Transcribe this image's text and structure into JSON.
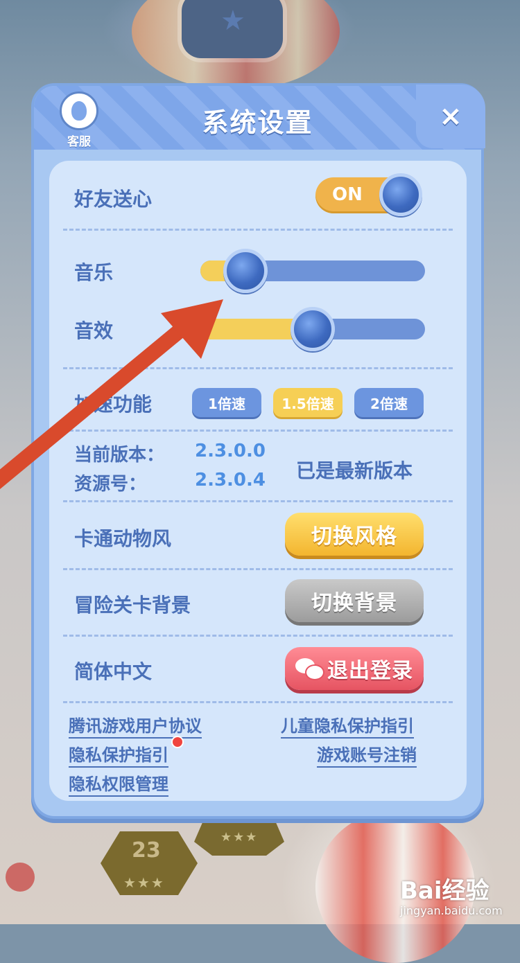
{
  "dialog": {
    "title": "系统设置",
    "service_label": "客服",
    "close_symbol": "×"
  },
  "friend_heart": {
    "label": "好友送心",
    "toggle_text": "ON",
    "enabled": true
  },
  "music": {
    "label": "音乐",
    "level": 0.2
  },
  "sound_effect": {
    "label": "音效",
    "level": 0.5
  },
  "speed": {
    "label": "加速功能",
    "options": [
      "1倍速",
      "1.5倍速",
      "2倍速"
    ],
    "selected": "1.5倍速"
  },
  "version": {
    "current_label": "当前版本：",
    "current_value": "2.3.0.0",
    "resource_label": "资源号：",
    "resource_value": "2.3.0.4",
    "status": "已是最新版本"
  },
  "style": {
    "label": "卡通动物风",
    "button": "切换风格"
  },
  "background": {
    "label": "冒险关卡背景",
    "button": "切换背景"
  },
  "language": {
    "label": "简体中文",
    "button": "退出登录"
  },
  "links": {
    "user_agreement": "腾讯游戏用户协议",
    "child_privacy": "儿童隐私保护指引",
    "privacy_guide": "隐私保护指引",
    "account_cancel": "游戏账号注销",
    "permission_manage": "隐私权限管理"
  },
  "background_game": {
    "level_number": "23",
    "stars": "★★★"
  },
  "watermark": {
    "main": "Bai经验",
    "sub": "jingyan.baidu.com"
  },
  "colors": {
    "accent_blue": "#4a70b8",
    "yellow": "#f3b52f",
    "red": "#e65462",
    "arrow": "#d94a2c"
  }
}
